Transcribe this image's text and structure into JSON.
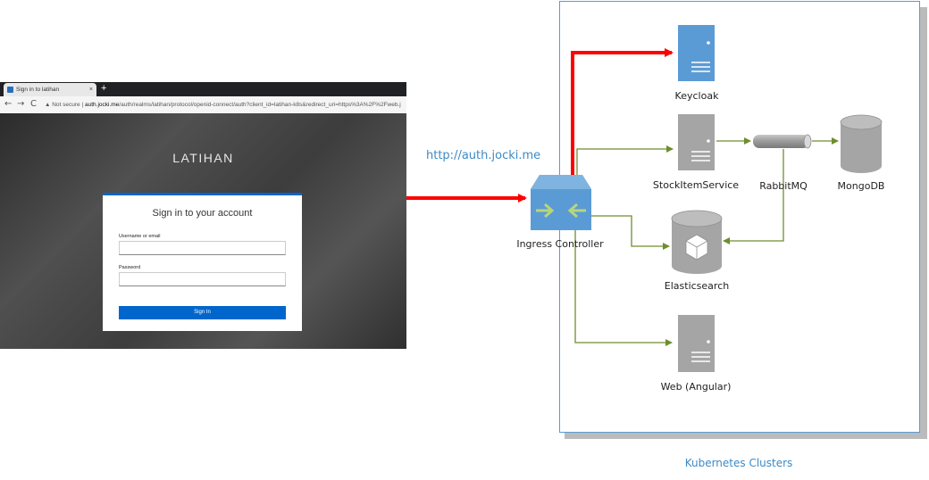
{
  "browser": {
    "tab_title": "Sign in to latihan",
    "new_tab": "+",
    "tab_close": "×",
    "nav": {
      "back": "←",
      "forward": "→",
      "reload": "C"
    },
    "url_prefix": "▲ Not secure | ",
    "url_host": "auth.jocki.me",
    "url_path": "/auth/realms/latihan/protocol/openid-connect/auth?client_id=latihan-k8s&redirect_uri=https%3A%2F%2Fweb.j"
  },
  "login": {
    "realm_title": "LATIHAN",
    "card_title": "Sign in to your account",
    "username_label": "Username or email",
    "password_label": "Password",
    "sign_in_button": "Sign In"
  },
  "diagram": {
    "url_label": "http://auth.jocki.me",
    "cluster_label": "Kubernetes Clusters",
    "nodes": {
      "keycloak": "Keycloak",
      "stockitemservice": "StockItemService",
      "rabbitmq": "RabbitMQ",
      "mongodb": "MongoDB",
      "ingress": "Ingress Controller",
      "elasticsearch": "Elasticsearch",
      "web": "Web (Angular)"
    },
    "colors": {
      "red_arrow": "#ff0000",
      "green_arrow": "#6e8e2e",
      "blue_server": "#5b9bd5",
      "gray_server": "#a5a5a5",
      "cluster_border": "#5b9bd5"
    }
  }
}
